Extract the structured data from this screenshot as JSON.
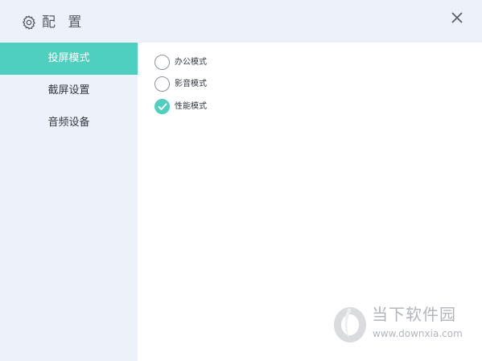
{
  "window": {
    "title": "配 置",
    "title_icon": "gear-icon",
    "close_icon": "close-icon"
  },
  "sidebar": {
    "items": [
      {
        "label": "投屏模式",
        "active": true
      },
      {
        "label": "截屏设置",
        "active": false
      },
      {
        "label": "音频设备",
        "active": false
      }
    ]
  },
  "modes": {
    "options": [
      {
        "label": "办公模式",
        "selected": false
      },
      {
        "label": "影音模式",
        "selected": false
      },
      {
        "label": "性能模式",
        "selected": true
      }
    ]
  },
  "watermark": {
    "brand": "当下软件园",
    "url": "www.downxia.com"
  },
  "colors": {
    "accent": "#4fcfbd",
    "sidebar_bg": "#edf1fa",
    "text": "#333a44"
  }
}
